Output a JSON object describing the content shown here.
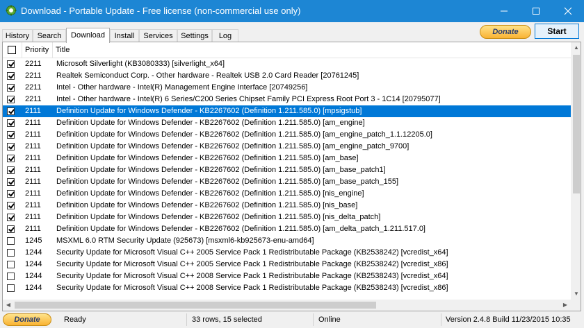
{
  "window": {
    "title": "Download - Portable Update  -  Free license (non-commercial use only)"
  },
  "tabs": [
    {
      "label": "History"
    },
    {
      "label": "Search"
    },
    {
      "label": "Download",
      "active": true
    },
    {
      "label": "Install"
    },
    {
      "label": "Services"
    },
    {
      "label": "Settings"
    },
    {
      "label": "Log"
    }
  ],
  "toolbar": {
    "donate_label": "Donate",
    "start_label": "Start"
  },
  "list": {
    "columns": {
      "priority": "Priority",
      "title": "Title"
    },
    "rows": [
      {
        "checked": true,
        "priority": "2211",
        "title": "Microsoft Silverlight (KB3080333) [silverlight_x64]"
      },
      {
        "checked": true,
        "priority": "2211",
        "title": "Realtek Semiconduct Corp. - Other hardware - Realtek USB 2.0 Card Reader [20761245]"
      },
      {
        "checked": true,
        "priority": "2211",
        "title": "Intel - Other hardware - Intel(R) Management Engine Interface [20749256]"
      },
      {
        "checked": true,
        "priority": "2211",
        "title": "Intel - Other hardware - Intel(R) 6 Series/C200 Series Chipset Family PCI Express Root Port 3 - 1C14 [20795077]"
      },
      {
        "checked": true,
        "priority": "2111",
        "title": "Definition Update for Windows Defender - KB2267602 (Definition 1.211.585.0) [mpsigstub]",
        "selected": true
      },
      {
        "checked": true,
        "priority": "2111",
        "title": "Definition Update for Windows Defender - KB2267602 (Definition 1.211.585.0) [am_engine]"
      },
      {
        "checked": true,
        "priority": "2111",
        "title": "Definition Update for Windows Defender - KB2267602 (Definition 1.211.585.0) [am_engine_patch_1.1.12205.0]"
      },
      {
        "checked": true,
        "priority": "2111",
        "title": "Definition Update for Windows Defender - KB2267602 (Definition 1.211.585.0) [am_engine_patch_9700]"
      },
      {
        "checked": true,
        "priority": "2111",
        "title": "Definition Update for Windows Defender - KB2267602 (Definition 1.211.585.0) [am_base]"
      },
      {
        "checked": true,
        "priority": "2111",
        "title": "Definition Update for Windows Defender - KB2267602 (Definition 1.211.585.0) [am_base_patch1]"
      },
      {
        "checked": true,
        "priority": "2111",
        "title": "Definition Update for Windows Defender - KB2267602 (Definition 1.211.585.0) [am_base_patch_155]"
      },
      {
        "checked": true,
        "priority": "2111",
        "title": "Definition Update for Windows Defender - KB2267602 (Definition 1.211.585.0) [nis_engine]"
      },
      {
        "checked": true,
        "priority": "2111",
        "title": "Definition Update for Windows Defender - KB2267602 (Definition 1.211.585.0) [nis_base]"
      },
      {
        "checked": true,
        "priority": "2111",
        "title": "Definition Update for Windows Defender - KB2267602 (Definition 1.211.585.0) [nis_delta_patch]"
      },
      {
        "checked": true,
        "priority": "2111",
        "title": "Definition Update for Windows Defender - KB2267602 (Definition 1.211.585.0) [am_delta_patch_1.211.517.0]"
      },
      {
        "checked": false,
        "priority": "1245",
        "title": "MSXML 6.0 RTM Security Update  (925673) [msxml6-kb925673-enu-amd64]"
      },
      {
        "checked": false,
        "priority": "1244",
        "title": "Security Update for Microsoft Visual C++ 2005 Service Pack 1 Redistributable Package (KB2538242) [vcredist_x64]"
      },
      {
        "checked": false,
        "priority": "1244",
        "title": "Security Update for Microsoft Visual C++ 2005 Service Pack 1 Redistributable Package (KB2538242) [vcredist_x86]"
      },
      {
        "checked": false,
        "priority": "1244",
        "title": "Security Update for Microsoft Visual C++ 2008 Service Pack 1 Redistributable Package (KB2538243) [vcredist_x64]"
      },
      {
        "checked": false,
        "priority": "1244",
        "title": "Security Update for Microsoft Visual C++ 2008 Service Pack 1 Redistributable Package (KB2538243) [vcredist_x86]"
      }
    ]
  },
  "statusbar": {
    "donate_label": "Donate",
    "state": "Ready",
    "counts": "33 rows, 15 selected",
    "connection": "Online",
    "version": "Version 2.4.8 Build 11/23/2015 10:35"
  },
  "colors": {
    "titlebar": "#1d86d4",
    "selection": "#0078d7",
    "donate": "#f9b233"
  },
  "icons": [
    "app-gear-icon",
    "minimize-icon",
    "maximize-icon",
    "close-icon",
    "scroll-up-icon",
    "scroll-down-icon",
    "scroll-left-icon",
    "scroll-right-icon"
  ]
}
